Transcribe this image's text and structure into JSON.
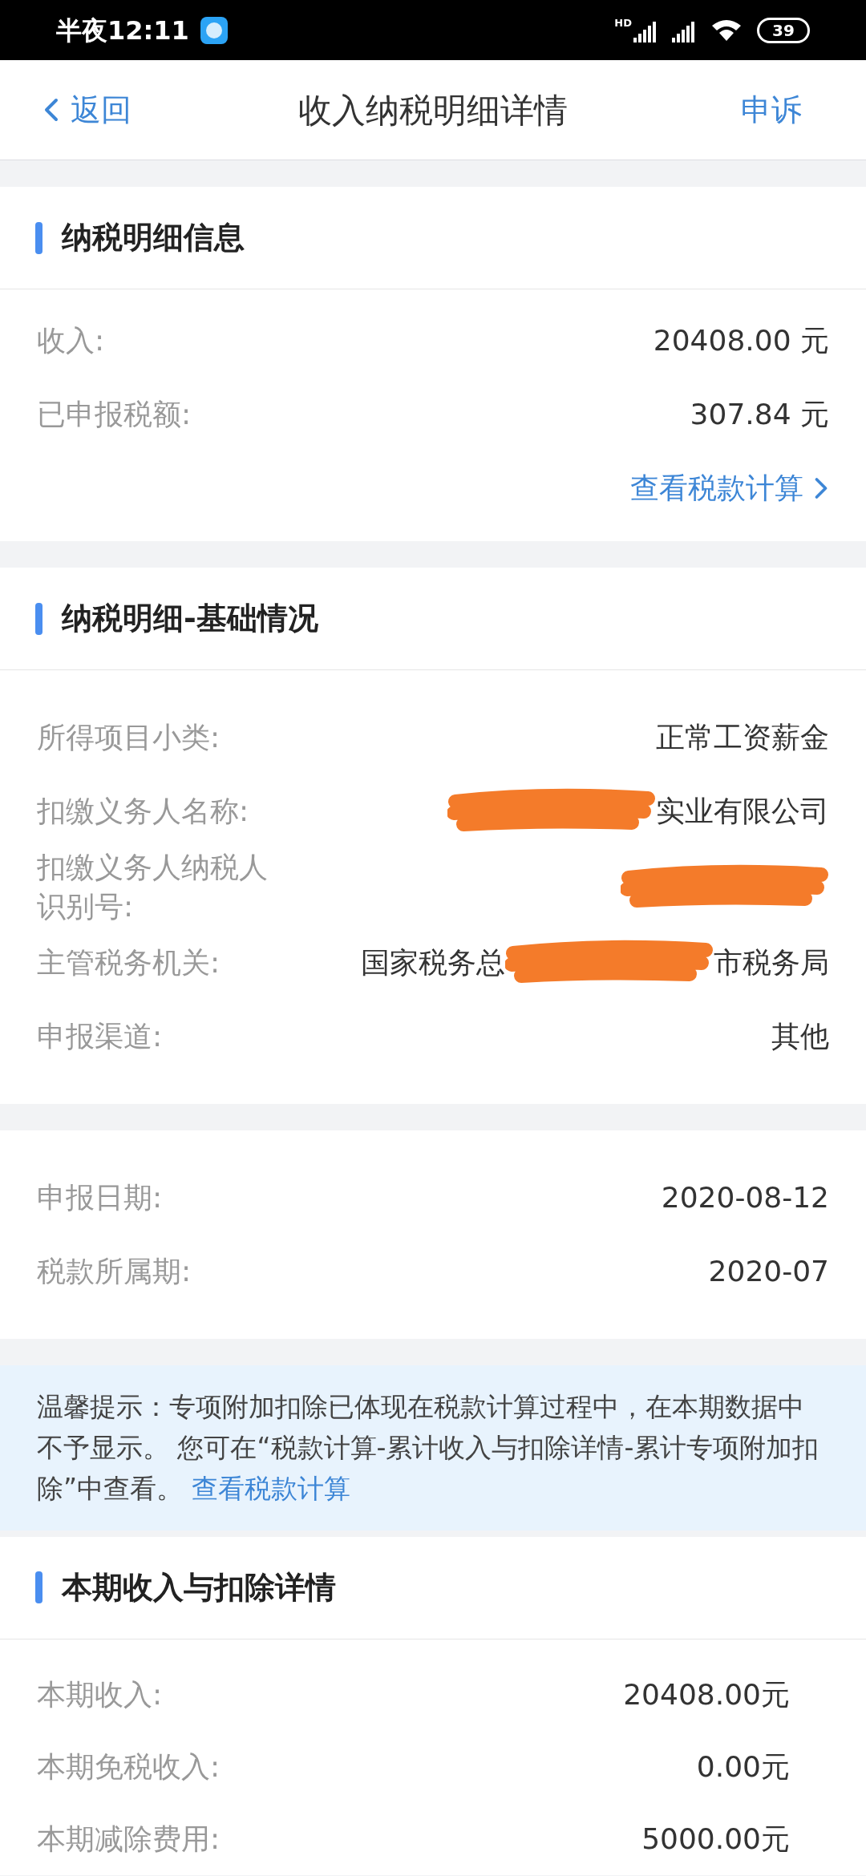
{
  "status_bar": {
    "time": "半夜12:11",
    "network": "HD",
    "battery": "39"
  },
  "nav": {
    "back": "返回",
    "title": "收入纳税明细详情",
    "action": "申诉"
  },
  "sections": [
    {
      "title": "纳税明细信息",
      "rows": [
        {
          "label": "收入:",
          "value": [
            {
              "kind": "text",
              "text": "20408.00 元"
            }
          ]
        },
        {
          "label": "已申报税额:",
          "value": [
            {
              "kind": "text",
              "text": "307.84 元"
            }
          ]
        }
      ],
      "link": "查看税款计算"
    },
    {
      "title": "纳税明细-基础情况",
      "rows": [
        {
          "label": "所得项目小类:",
          "value": [
            {
              "kind": "text",
              "text": "正常工资薪金"
            }
          ]
        },
        {
          "label": "扣缴义务人名称:",
          "value": [
            {
              "kind": "redaction"
            },
            {
              "kind": "text",
              "text": "实业有限公司"
            }
          ]
        },
        {
          "label": "扣缴义务人纳税人识别号:",
          "value": [
            {
              "kind": "redaction"
            }
          ]
        },
        {
          "label": "主管税务机关:",
          "value": [
            {
              "kind": "text",
              "text": "国家税务总"
            },
            {
              "kind": "redaction"
            },
            {
              "kind": "text",
              "text": "市税务局"
            }
          ]
        },
        {
          "label": "申报渠道:",
          "value": [
            {
              "kind": "text",
              "text": "其他"
            }
          ]
        }
      ]
    },
    {
      "rows": [
        {
          "label": "申报日期:",
          "value": [
            {
              "kind": "text",
              "text": "2020-08-12"
            }
          ]
        },
        {
          "label": "税款所属期:",
          "value": [
            {
              "kind": "text",
              "text": "2020-07"
            }
          ]
        }
      ]
    }
  ],
  "notice": {
    "text": "温馨提示：专项附加扣除已体现在税款计算过程中，在本期数据中不予显示。 您可在“税款计算-累计收入与扣除详情-累计专项附加扣除”中查看。",
    "link": "查看税款计算"
  },
  "detail": {
    "title": "本期收入与扣除详情",
    "rows": [
      {
        "label": "本期收入:",
        "value": "20408.00元"
      },
      {
        "label": "本期免税收入:",
        "value": "0.00元"
      },
      {
        "label": "本期减除费用:",
        "value": "5000.00元"
      }
    ]
  }
}
